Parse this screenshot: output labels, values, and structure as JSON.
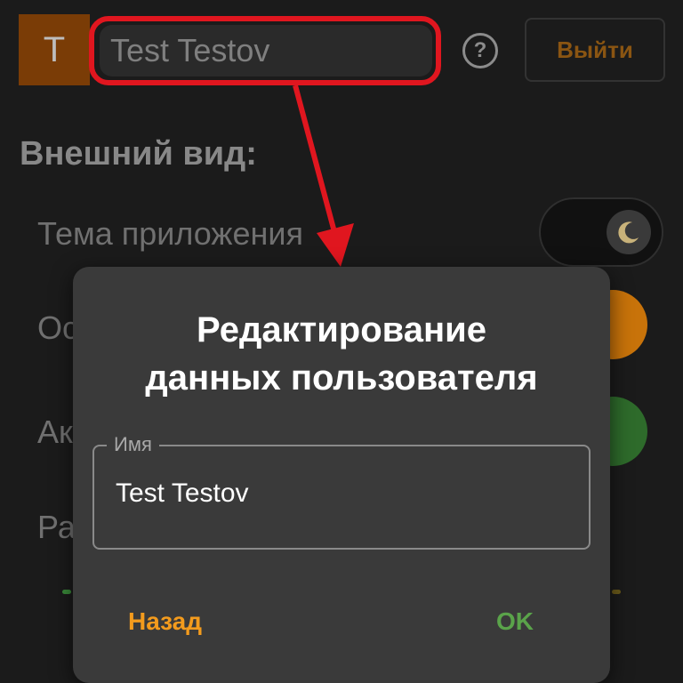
{
  "header": {
    "avatar_letter": "T",
    "user_name": "Test Testov",
    "help_symbol": "?",
    "logout_label": "Выйти"
  },
  "settings": {
    "section_title": "Внешний вид:",
    "theme_label": "Тема приложения",
    "row2_partial": "Ос",
    "row3_partial": "Ак",
    "row4_partial": "Ра",
    "theme_mode": "dark",
    "color_orange": "#c8730a",
    "color_green": "#2e6b2b"
  },
  "dialog": {
    "title": "Редактирование\nданных пользователя",
    "field_label": "Имя",
    "field_value": "Test Testov",
    "back_label": "Назад",
    "ok_label": "OK"
  },
  "annotation": {
    "color": "#e0161f"
  }
}
